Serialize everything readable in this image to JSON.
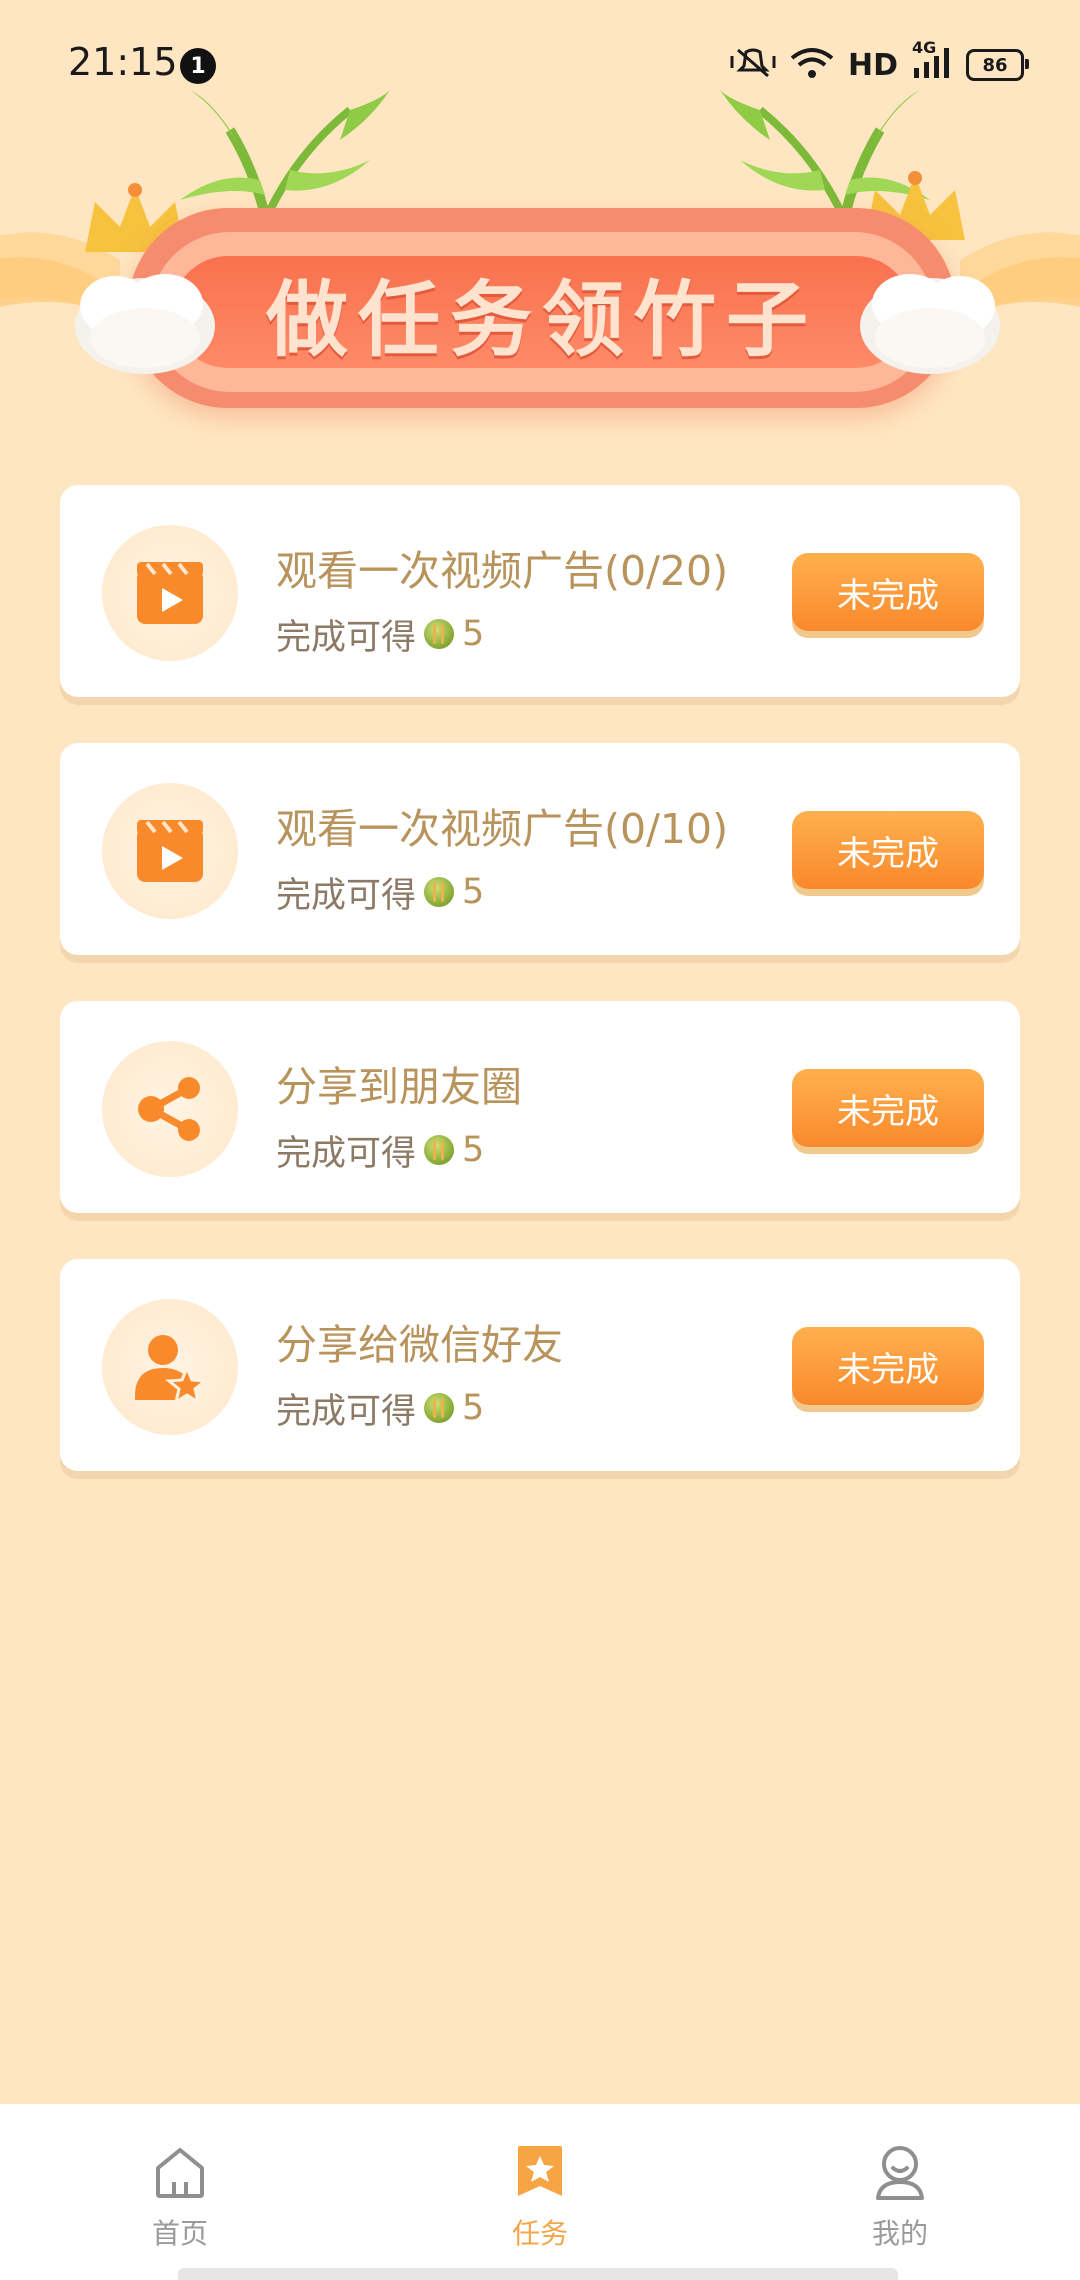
{
  "status_bar": {
    "time": "21:15",
    "notification_count": "1",
    "network_label": "HD",
    "signal_label": "4G",
    "battery": "86"
  },
  "banner": {
    "title": "做任务领竹子"
  },
  "tasks": [
    {
      "title": "观看一次视频广告(0/20)",
      "reward_prefix": "完成可得",
      "reward_value": "5",
      "button_label": "未完成",
      "icon": "video-ad-icon"
    },
    {
      "title": "观看一次视频广告(0/10)",
      "reward_prefix": "完成可得",
      "reward_value": "5",
      "button_label": "未完成",
      "icon": "video-ad-icon"
    },
    {
      "title": "分享到朋友圈",
      "reward_prefix": "完成可得",
      "reward_value": "5",
      "button_label": "未完成",
      "icon": "share-icon"
    },
    {
      "title": "分享给微信好友",
      "reward_prefix": "完成可得",
      "reward_value": "5",
      "button_label": "未完成",
      "icon": "user-star-icon"
    }
  ],
  "nav": {
    "items": [
      {
        "label": "首页",
        "icon": "home-icon"
      },
      {
        "label": "任务",
        "icon": "task-star-icon",
        "active": true
      },
      {
        "label": "我的",
        "icon": "profile-icon"
      }
    ]
  },
  "colors": {
    "background": "#FFE6C2",
    "accent_orange": "#F9892C",
    "title_gold": "#B8935C",
    "nav_active": "#F3A54A"
  }
}
